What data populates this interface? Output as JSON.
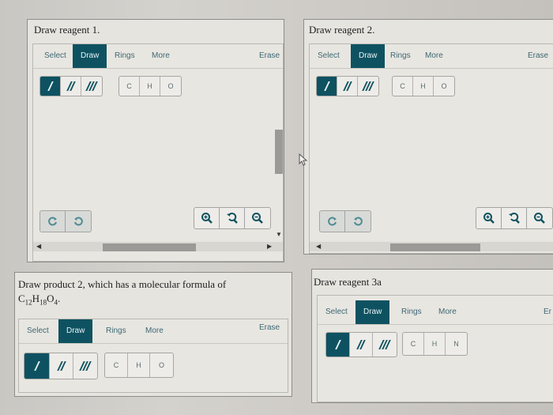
{
  "panels": [
    {
      "id": "reagent-1",
      "title": "Draw reagent 1.",
      "tabs": [
        "Select",
        "Draw",
        "Rings",
        "More"
      ],
      "active_tab": "Draw",
      "erase_label": "Erase",
      "bond_tools": [
        "single-bond",
        "double-bond",
        "triple-bond"
      ],
      "atoms": [
        "C",
        "H",
        "O"
      ],
      "undo_redo": [
        "undo-icon",
        "redo-icon"
      ],
      "zoom_tools": [
        "zoom-in-icon",
        "reset-zoom-icon",
        "zoom-out-icon"
      ]
    },
    {
      "id": "reagent-2",
      "title": "Draw reagent 2.",
      "tabs": [
        "Select",
        "Draw",
        "Rings",
        "More"
      ],
      "active_tab": "Draw",
      "erase_label": "Erase",
      "bond_tools": [
        "single-bond",
        "double-bond",
        "triple-bond"
      ],
      "atoms": [
        "C",
        "H",
        "O"
      ],
      "undo_redo": [
        "undo-icon",
        "redo-icon"
      ],
      "zoom_tools": [
        "zoom-in-icon",
        "reset-zoom-icon",
        "zoom-out-icon"
      ]
    },
    {
      "id": "product-2",
      "title": "Draw product 2, which has a molecular formula of",
      "formula": {
        "parts": [
          [
            "C",
            "12"
          ],
          [
            "H",
            "18"
          ],
          [
            "O",
            "4"
          ]
        ],
        "suffix": "."
      },
      "tabs": [
        "Select",
        "Draw",
        "Rings",
        "More"
      ],
      "active_tab": "Draw",
      "erase_label": "Erase",
      "bond_tools": [
        "single-bond",
        "double-bond",
        "triple-bond"
      ],
      "atoms": [
        "C",
        "H",
        "O"
      ]
    },
    {
      "id": "reagent-3a",
      "title": "Draw reagent 3a",
      "tabs": [
        "Select",
        "Draw",
        "Rings",
        "More"
      ],
      "active_tab": "Draw",
      "erase_label": "Er",
      "bond_tools": [
        "single-bond",
        "double-bond",
        "triple-bond"
      ],
      "atoms": [
        "C",
        "H",
        "N"
      ]
    }
  ],
  "colors": {
    "accent": "#0e5261",
    "tab_text": "#3d6873",
    "panel_bg": "#e6e4df"
  }
}
